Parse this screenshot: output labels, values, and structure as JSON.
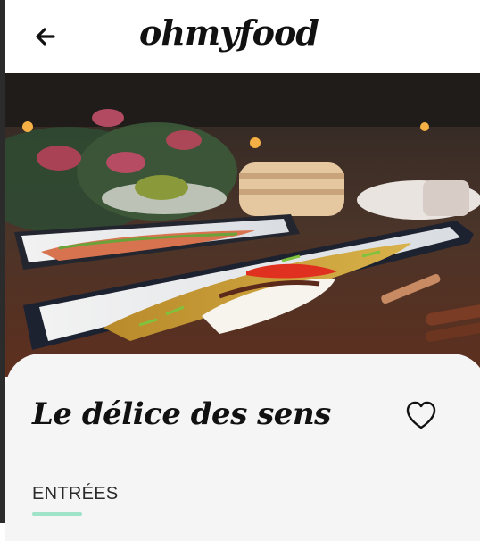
{
  "header": {
    "brand": "ohmyfood",
    "back_icon": "arrow-left-icon"
  },
  "hero": {
    "image": "restaurant-dish-photo"
  },
  "restaurant": {
    "name": "Le délice des sens",
    "favorite_icon": "heart-outline-icon"
  },
  "menu": {
    "section_label": "ENTRÉES",
    "accent_color": "#9fe3c8"
  }
}
